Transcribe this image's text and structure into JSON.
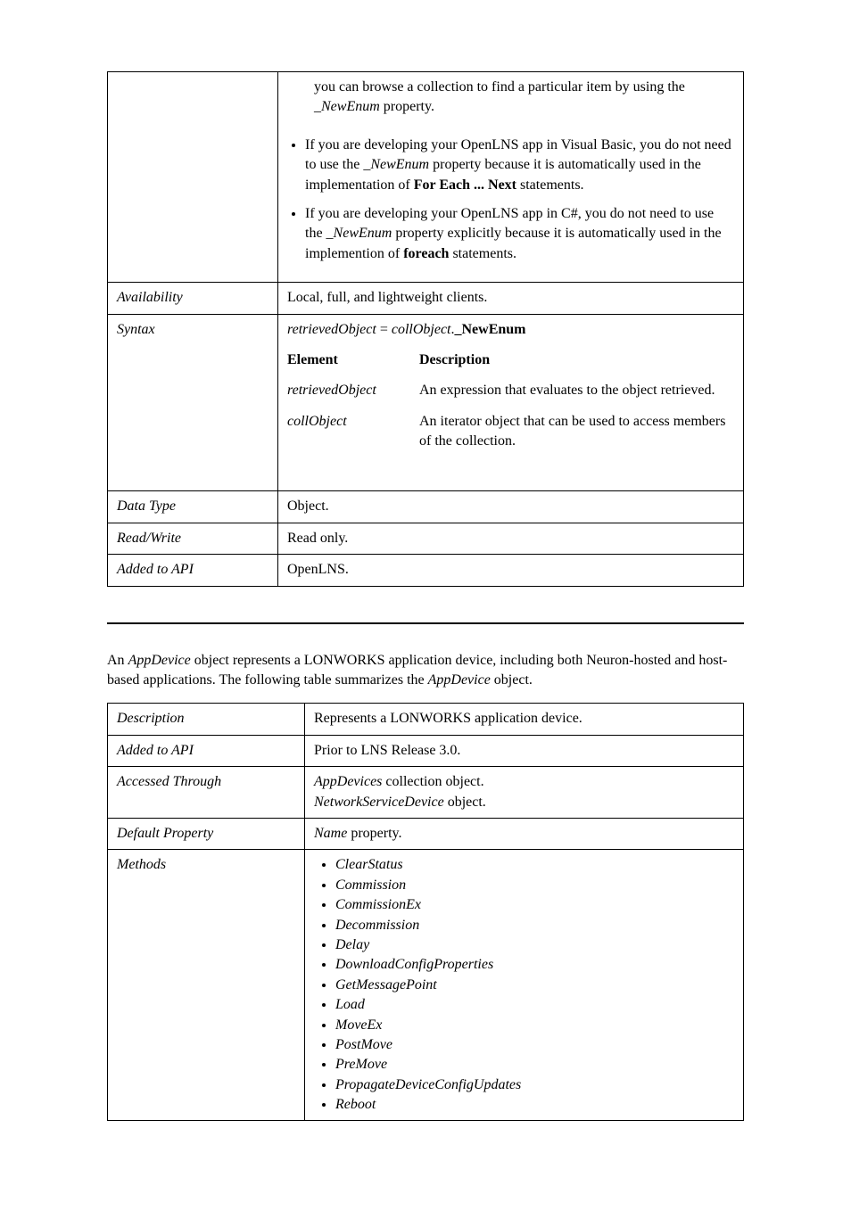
{
  "table1": {
    "row1_intro": "you can browse a collection to find a particular item by using the ",
    "row1_prop": "_NewEnum",
    "row1_intro_end": " property.",
    "bullet1_a": "If you are developing your OpenLNS app in Visual Basic, you do not need to use the ",
    "bullet1_prop": "_NewEnum",
    "bullet1_b": " property because it is automatically used in the implementation of ",
    "bullet1_bold": "For Each ... Next",
    "bullet1_c": " statements.",
    "bullet2_a": "If you are developing your OpenLNS app in C#, you do not need to use the ",
    "bullet2_prop": "_NewEnum",
    "bullet2_b": " property explicitly because it is automatically used in the implemention of ",
    "bullet2_bold": "foreach",
    "bullet2_c": " statements.",
    "availability_label": "Availability",
    "availability_value": "Local, full, and lightweight clients.",
    "syntax_label": "Syntax",
    "syntax_retrieved": "retrievedObject",
    "syntax_eq": " = ",
    "syntax_coll": "collObject",
    "syntax_dot": ".",
    "syntax_newenum": "_NewEnum",
    "element_header": "Element",
    "desc_header": "Description",
    "retrieved_label": "retrievedObject",
    "retrieved_desc": "An expression that evaluates to the object retrieved.",
    "coll_label": "collObject",
    "coll_desc": "An iterator object that can be used to access members of the collection.",
    "datatype_label": "Data Type",
    "datatype_value": "Object.",
    "readwrite_label": "Read/Write",
    "readwrite_value": "Read only.",
    "addedapi_label": "Added to API",
    "addedapi_value": "OpenLNS."
  },
  "paragraph": {
    "p1": "An ",
    "p1_app": "AppDevice",
    "p2": "  object represents a LONWORKS application device, including both Neuron-hosted and host-based applications.  The following table summarizes the ",
    "p2_app": "AppDevice",
    "p3": " object."
  },
  "table2": {
    "desc_label": "Description",
    "desc_value": "Represents a LONWORKS application device.",
    "added_label": "Added to API",
    "added_value": "Prior to LNS Release 3.0.",
    "accessed_label": "Accessed Through",
    "accessed_app": "AppDevices",
    "accessed_app_suffix": " collection object.",
    "accessed_net": "NetworkServiceDevice",
    "accessed_net_suffix": " object.",
    "default_label": "Default Property",
    "default_name": "Name",
    "default_suffix": " property.",
    "methods_label": "Methods",
    "methods": {
      "m0": "ClearStatus",
      "m1": "Commission",
      "m2": "CommissionEx",
      "m3": "Decommission",
      "m4": "Delay",
      "m5": "DownloadConfigProperties",
      "m6": "GetMessagePoint",
      "m7": "Load",
      "m8": "MoveEx",
      "m9": "PostMove",
      "m10": "PreMove",
      "m11": "PropagateDeviceConfigUpdates",
      "m12": "Reboot"
    }
  }
}
